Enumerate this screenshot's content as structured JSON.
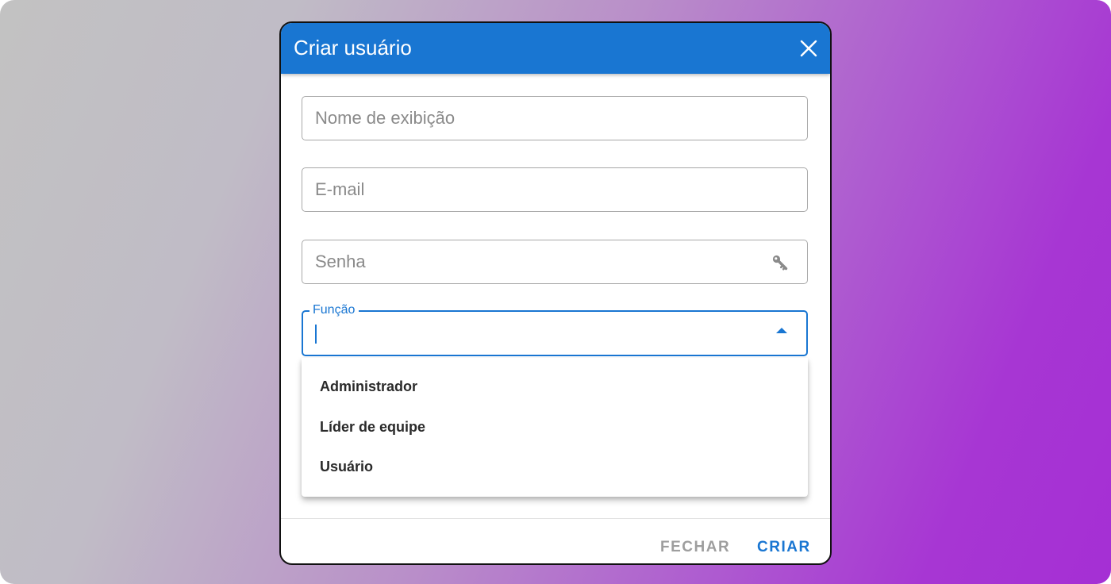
{
  "dialog": {
    "title": "Criar usuário",
    "close_icon": "close-icon"
  },
  "form": {
    "display_name": {
      "placeholder": "Nome de exibição",
      "value": ""
    },
    "email": {
      "placeholder": "E-mail",
      "value": ""
    },
    "password": {
      "placeholder": "Senha",
      "value": "",
      "icon": "key-icon"
    },
    "role": {
      "label": "Função",
      "value": "",
      "icon": "arrow-up-icon",
      "options": [
        "Administrador",
        "Líder de equipe",
        "Usuário"
      ]
    }
  },
  "footer": {
    "close_label": "FECHAR",
    "create_label": "CRIAR"
  },
  "colors": {
    "primary": "#1976d2",
    "muted": "#9e9e9e",
    "border": "#a8a8a8"
  }
}
